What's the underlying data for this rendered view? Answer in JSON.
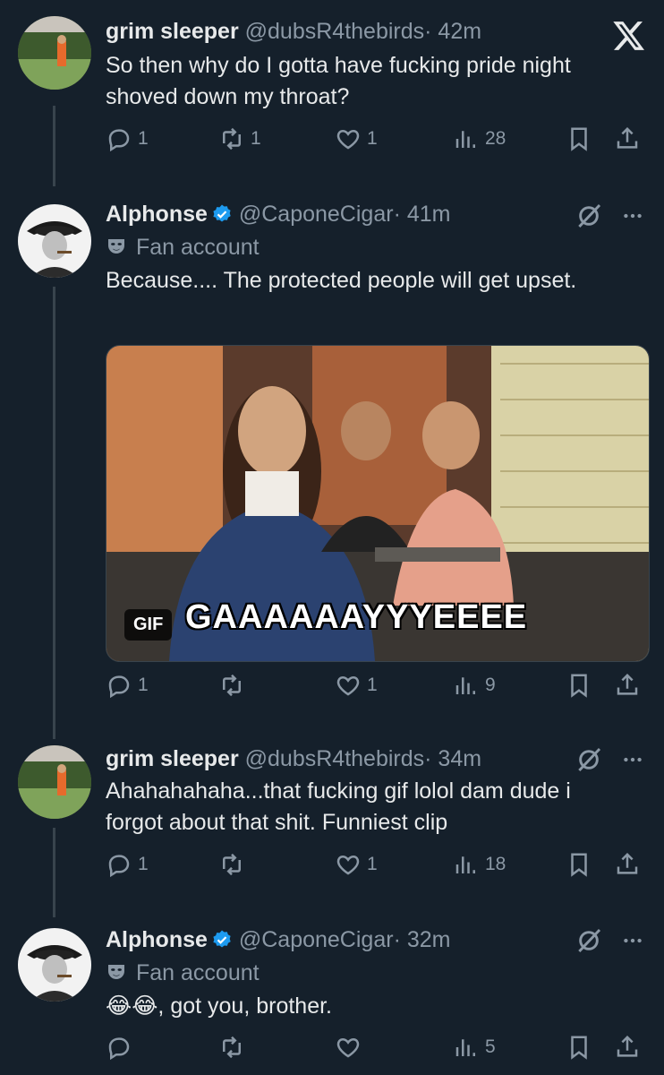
{
  "tweets": [
    {
      "name": "grim sleeper",
      "handle": "@dubsR4thebirds",
      "time": "· 42m",
      "text": "So then why do I gotta have fucking pride night shoved down my throat?",
      "replies": "1",
      "reposts": "1",
      "likes": "1",
      "views": "28"
    },
    {
      "name": "Alphonse",
      "handle": "@CaponeCigar",
      "time": "· 41m",
      "badge": "Fan account",
      "text": "Because.... The protected people will get upset.",
      "gif_label": "GIF",
      "gif_caption": "GAAAAAAYYYEEEE",
      "replies": "1",
      "reposts": "",
      "likes": "1",
      "views": "9"
    },
    {
      "name": "grim sleeper",
      "handle": "@dubsR4thebirds",
      "time": "· 34m",
      "text": "Ahahahahaha...that fucking gif lolol dam dude i forgot about that shit. Funniest clip",
      "replies": "1",
      "reposts": "",
      "likes": "1",
      "views": "18"
    },
    {
      "name": "Alphonse",
      "handle": "@CaponeCigar",
      "time": "· 32m",
      "badge": "Fan account",
      "text": "😂😂, got you, brother.",
      "replies": "",
      "reposts": "",
      "likes": "",
      "views": "5"
    }
  ],
  "colors": {
    "background": "#15202b",
    "text": "#e7e9ea",
    "secondary": "#8b98a5",
    "verified": "#1d9bf0"
  },
  "icons": [
    "x-logo-icon",
    "reply-icon",
    "repost-icon",
    "like-icon",
    "views-icon",
    "bookmark-icon",
    "share-icon",
    "muted-icon",
    "more-icon",
    "verified-icon",
    "mask-icon"
  ]
}
